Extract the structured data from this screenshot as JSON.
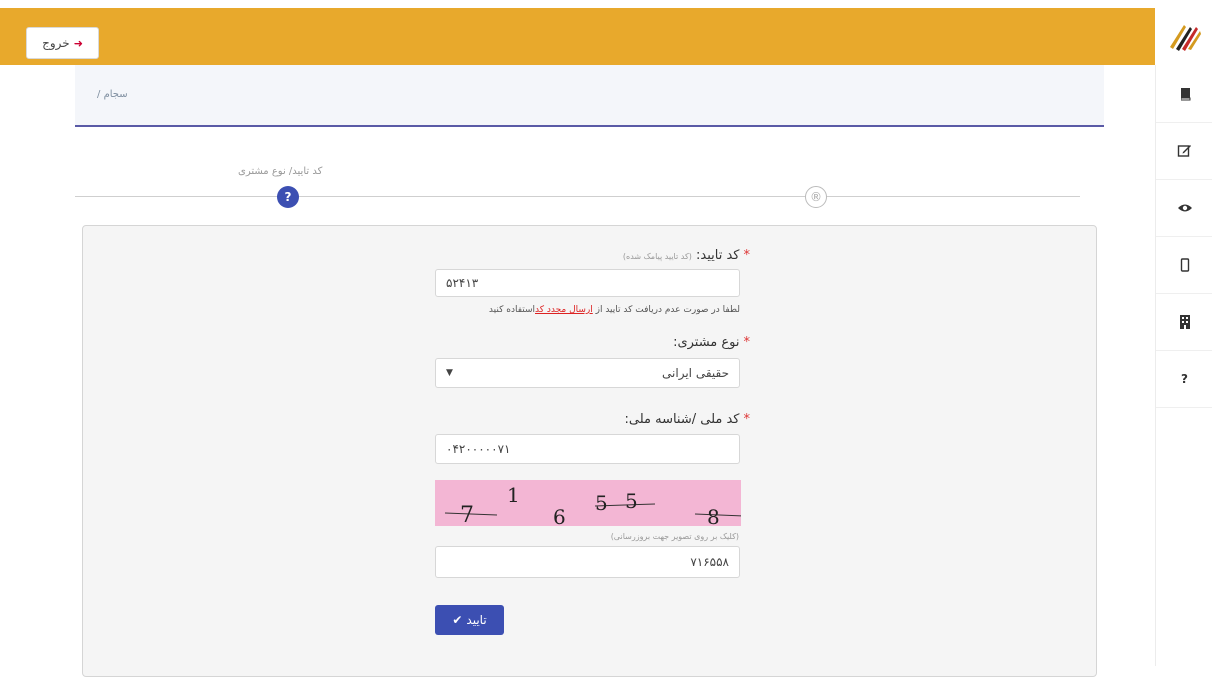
{
  "topbar": {
    "logout_label": "خروج",
    "logout_icon": "sign-out-icon",
    "color": "#e8a92c"
  },
  "breadcrumb": {
    "root": "سجام",
    "separator": "/"
  },
  "steps": {
    "current_label": "کد تایید/ نوع مشتری",
    "current_symbol": "?",
    "next_symbol": "®"
  },
  "sidebar": {
    "items": [
      {
        "icon": "book-icon"
      },
      {
        "icon": "edit-icon"
      },
      {
        "icon": "eye-icon"
      },
      {
        "icon": "mobile-icon"
      },
      {
        "icon": "building-icon"
      },
      {
        "icon": "question-icon",
        "symbol": "?"
      }
    ]
  },
  "form": {
    "verify_code": {
      "label": "کد تایید:",
      "hint": "(کد تایید پیامک شده)",
      "value": "۵۲۴۱۳",
      "note_before": "لطفا در صورت عدم دریافت کد تایید از ",
      "note_link": "ارسال مجدد کد",
      "note_after": "استفاده کنید"
    },
    "customer_type": {
      "label": "نوع مشتری:",
      "selected": "حقیقی ایرانی",
      "arrow": "▼"
    },
    "national_id": {
      "label": "کد ملی /شناسه ملی:",
      "value": "۰۴۲۰۰۰۰۰۷۱"
    },
    "captcha": {
      "image_text": "716558",
      "hint": "(کلیک بر روی تصویر جهت بروزرسانی)",
      "value": "۷۱۶۵۵۸"
    },
    "submit_label": "تایید"
  },
  "colors": {
    "primary": "#3c4fb2",
    "accent": "#e8a92c",
    "captcha_bg": "#f3b6d4",
    "required": "#d33333"
  }
}
